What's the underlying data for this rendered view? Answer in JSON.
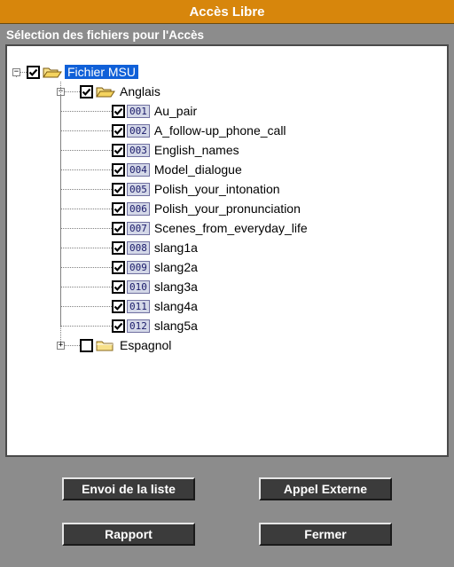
{
  "window": {
    "title": "Accès Libre"
  },
  "panel": {
    "heading": "Sélection des fichiers pour l'Accès"
  },
  "tree": {
    "root": {
      "label": "Fichier MSU",
      "checked": true,
      "expanded": true,
      "selected": true
    },
    "folders": [
      {
        "label": "Anglais",
        "checked": true,
        "expanded": true,
        "items": [
          {
            "num": "001",
            "label": "Au_pair",
            "checked": true
          },
          {
            "num": "002",
            "label": "A_follow-up_phone_call",
            "checked": true
          },
          {
            "num": "003",
            "label": "English_names",
            "checked": true
          },
          {
            "num": "004",
            "label": "Model_dialogue",
            "checked": true
          },
          {
            "num": "005",
            "label": "Polish_your_intonation",
            "checked": true
          },
          {
            "num": "006",
            "label": "Polish_your_pronunciation",
            "checked": true
          },
          {
            "num": "007",
            "label": "Scenes_from_everyday_life",
            "checked": true
          },
          {
            "num": "008",
            "label": "slang1a",
            "checked": true
          },
          {
            "num": "009",
            "label": "slang2a",
            "checked": true
          },
          {
            "num": "010",
            "label": "slang3a",
            "checked": true
          },
          {
            "num": "011",
            "label": "slang4a",
            "checked": true
          },
          {
            "num": "012",
            "label": "slang5a",
            "checked": true
          }
        ]
      },
      {
        "label": "Espagnol",
        "checked": false,
        "expanded": false,
        "items": []
      }
    ]
  },
  "buttons": {
    "send_list": "Envoi de la liste",
    "external_call": "Appel Externe",
    "report": "Rapport",
    "close": "Fermer"
  },
  "colors": {
    "title_bar": "#d7860c",
    "background": "#8c8c8c",
    "selection": "#1060d8",
    "button": "#3b3b3b",
    "folder_open": "#f4d35e",
    "folder_closed": "#f7e08a"
  }
}
